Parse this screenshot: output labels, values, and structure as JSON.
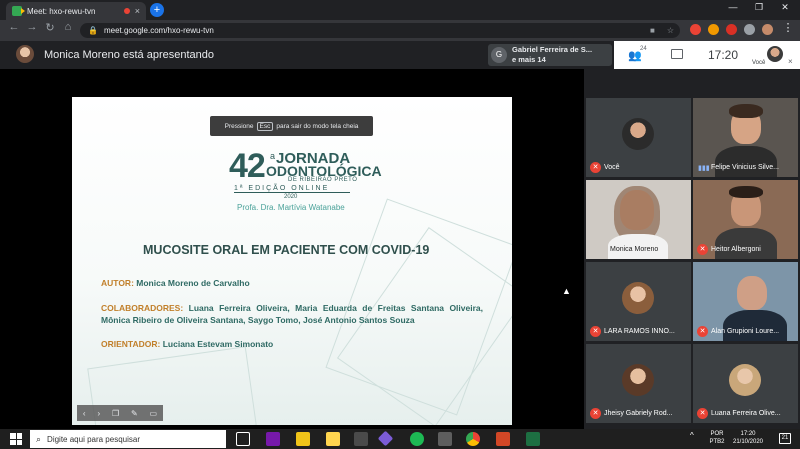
{
  "browser": {
    "tab_title": "Meet: hxo-rewu-tvn",
    "tab_close": "×",
    "newtab": "+",
    "url": "meet.google.com/hxo-rewu-tvn",
    "win_min": "—",
    "win_max": "❐",
    "win_close": "✕"
  },
  "meet": {
    "presenter_text": "Monica Moreno está apresentando",
    "notification": {
      "initial": "G",
      "line1": "Gabriel Ferreira de S...",
      "line2": "e mais 14"
    },
    "people_count": "24",
    "clock": "17:20",
    "self_label": "Você",
    "close_glyph": "×"
  },
  "slide": {
    "fullscreen_msg_before": "Pressione",
    "fullscreen_key": "Esc",
    "fullscreen_msg_after": "para sair do modo tela cheia",
    "logo_num": "42",
    "logo_sup": "a",
    "logo_line1": "JORNADA",
    "logo_line2": "ODONTOLÓGICA",
    "logo_line3": "DE RIBEIRÃO PRETO",
    "logo_edition": "1ª EDIÇÃO ONLINE",
    "logo_year": "2020",
    "logo_prof": "Profa. Dra. Martívia Watanabe",
    "title": "MUCOSITE ORAL EM PACIENTE COM COVID-19",
    "autor_label": "AUTOR:",
    "autor": "Monica Moreno de Carvalho",
    "colab_label": "COLABORADORES:",
    "colab": "Luana Ferreira Oliveira, Maria Eduarda de Freitas Santana Oliveira, Mônica Ribeiro de Oliveira Santana, Saygo Tomo, José Antonio Santos Souza",
    "orient_label": "ORIENTADOR:",
    "orient": "Luciana Estevam Simonato"
  },
  "participants": [
    {
      "name": "Você",
      "muted": true
    },
    {
      "name": "Felipe Vinicius Silve...",
      "muted": false
    },
    {
      "name": "Monica Moreno",
      "muted": false
    },
    {
      "name": "Heitor Albergoni",
      "muted": true
    },
    {
      "name": "LARA RAMOS INNO...",
      "muted": true
    },
    {
      "name": "Alan Grupioni Loure...",
      "muted": true
    },
    {
      "name": "Jheisy Gabriely Rod...",
      "muted": true
    },
    {
      "name": "Luana Ferreira Olive...",
      "muted": true
    }
  ],
  "taskbar": {
    "search_placeholder": "Digite aqui para pesquisar",
    "lang1": "POR",
    "lang2": "PTB2",
    "time": "17:20",
    "date": "21/10/2020",
    "notif_count": "21"
  }
}
